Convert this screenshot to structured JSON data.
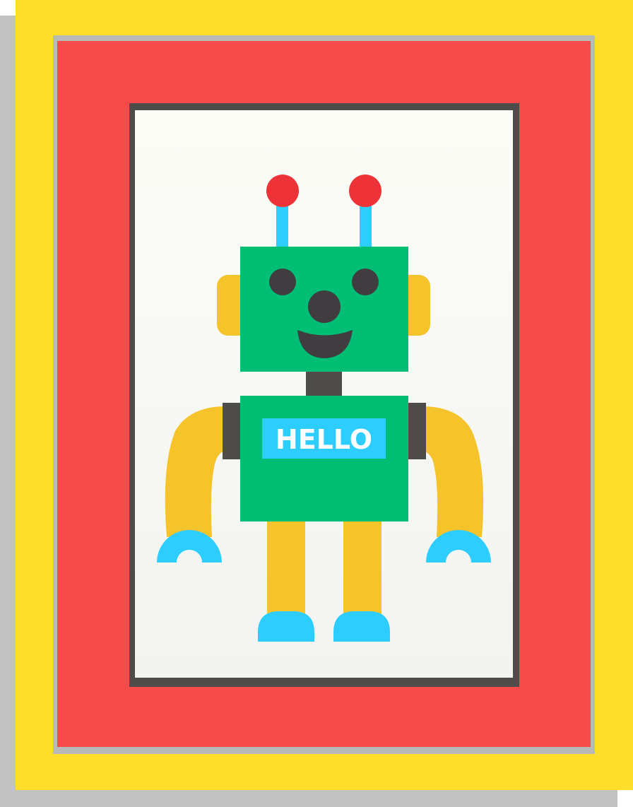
{
  "poster": {
    "badge_text": "HELLO"
  },
  "colors": {
    "shadow": "#c2c2c2",
    "outer_frame": "#ffdf2b",
    "inner_frame": "#f54b4b",
    "frame_edge": "#b9b9b9",
    "picture_border": "#4d4c4b",
    "picture_bg_top": "#fcfcf7",
    "picture_bg_bottom": "#f3f3f1",
    "robot_body": "#00bf75",
    "robot_limbs": "#f5c42b",
    "robot_accent": "#2ecdff",
    "robot_dark": "#403c40",
    "robot_joint": "#4d4c4b",
    "antenna_ball": "#ee3338",
    "badge_text": "#ffffff"
  },
  "icons": {
    "figure": "robot-icon"
  }
}
